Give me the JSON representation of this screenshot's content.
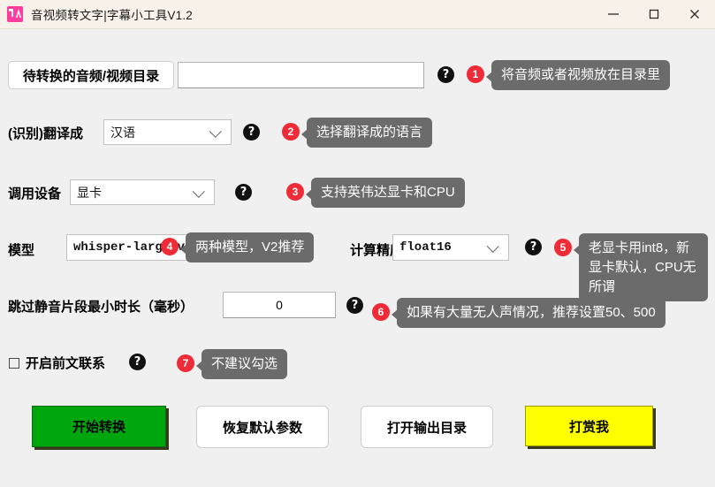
{
  "window": {
    "title": "音视频转文字|字幕小工具V1.2",
    "icon": "app-logo-icon",
    "controls": {
      "minimize": "minimize-icon",
      "maximize": "maximize-icon",
      "close": "close-icon"
    }
  },
  "rows": {
    "directory": {
      "label": "待转换的音频/视频目录",
      "value": "",
      "placeholder": "",
      "help": "?",
      "badge": "1",
      "tip": "将音频或者视频放在目录里"
    },
    "translate": {
      "label": "(识别)翻译成",
      "value": "汉语",
      "help": "?",
      "badge": "2",
      "tip": "选择翻译成的语言"
    },
    "device": {
      "label": "调用设备",
      "value": "显卡",
      "help": "?",
      "badge": "3",
      "tip": "支持英伟达显卡和CPU"
    },
    "model": {
      "label": "模型",
      "value": "whisper-large-v2",
      "badge": "4",
      "tip": "两种模型，V2推荐",
      "help": "?"
    },
    "precision": {
      "label": "计算精度",
      "value": "float16",
      "help": "?",
      "badge": "5",
      "tip": "老显卡用int8，新显卡默认，CPU无所谓"
    },
    "silence": {
      "label": "跳过静音片段最小时长（毫秒）",
      "value": "0",
      "help": "?",
      "badge": "6",
      "tip": "如果有大量无人声情况，推荐设置50、500"
    },
    "context": {
      "label": "开启前文联系",
      "checked": false,
      "help": "?",
      "badge": "7",
      "tip": "不建议勾选"
    }
  },
  "buttons": {
    "start": "开始转换",
    "reset": "恢复默认参数",
    "open_output": "打开输出目录",
    "donate": "打赏我"
  },
  "colors": {
    "titlebar": "#f8f1e9",
    "background": "#f0f0f0",
    "badge": "#ee2b37",
    "tooltip": "#6b6b6b",
    "start_button": "#00a60e",
    "donate_button": "#ffff00",
    "app_icon": "#ff3d9e"
  }
}
